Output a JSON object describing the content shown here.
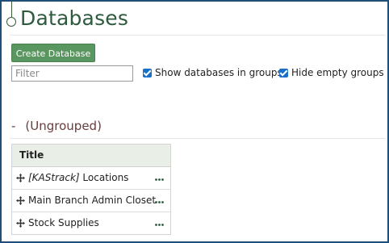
{
  "page": {
    "title": "Databases"
  },
  "toolbar": {
    "create_label": "Create Database",
    "filter_placeholder": "Filter",
    "filter_value": "",
    "show_groups_label": "Show databases in groups",
    "show_groups_checked": true,
    "hide_empty_label": "Hide empty groups",
    "hide_empty_checked": true
  },
  "group": {
    "toggle": "-",
    "name": "(Ungrouped)"
  },
  "table": {
    "header": "Title",
    "rows": [
      {
        "tag": "[KAStrack]",
        "label": " Locations",
        "move_icon": "move-icon",
        "menu_icon": "more-icon"
      },
      {
        "tag": "",
        "label": "Main Branch Admin Closet",
        "move_icon": "move-icon",
        "menu_icon": "more-icon"
      },
      {
        "tag": "",
        "label": "Stock Supplies",
        "move_icon": "move-icon",
        "menu_icon": "more-icon"
      }
    ]
  },
  "colors": {
    "title": "#2e5a3e",
    "button_bg": "#5a9660",
    "checkbox": "#1a6fc9",
    "group_heading": "#6a3c3c",
    "table_header_bg": "#e9efe7",
    "frame_border": "#1f4e79"
  }
}
